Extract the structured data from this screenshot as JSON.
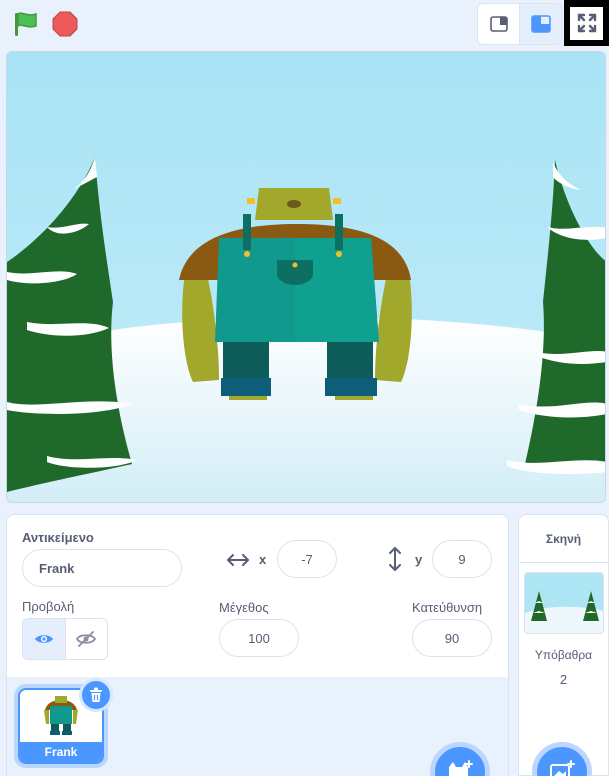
{
  "topbar": {
    "icons": [
      "green-flag-icon",
      "stop-icon",
      "small-stage-icon",
      "large-stage-icon",
      "fullscreen-icon"
    ],
    "colors": {
      "flag": "#4cbf56",
      "stop": "#ec5959"
    }
  },
  "stage": {
    "sprite_name": "Frank",
    "backdrop": "winter"
  },
  "sprite_info": {
    "sprite_label": "Αντικείμενο",
    "name": "Frank",
    "x_label": "x",
    "x_value": "-7",
    "y_label": "y",
    "y_value": "9",
    "show_label": "Προβολή",
    "size_label": "Μέγεθος",
    "size_value": "100",
    "direction_label": "Κατεύθυνση",
    "direction_value": "90"
  },
  "sprite_list": {
    "sprites": [
      {
        "name": "Frank",
        "selected": true
      }
    ]
  },
  "stage_pane": {
    "title": "Σκηνή",
    "backdrops_label": "Υπόβαθρα",
    "backdrops_count": "2"
  },
  "colors": {
    "accent": "#4c97ff",
    "text": "#575e75",
    "panel_bg": "#e9f1fc"
  }
}
